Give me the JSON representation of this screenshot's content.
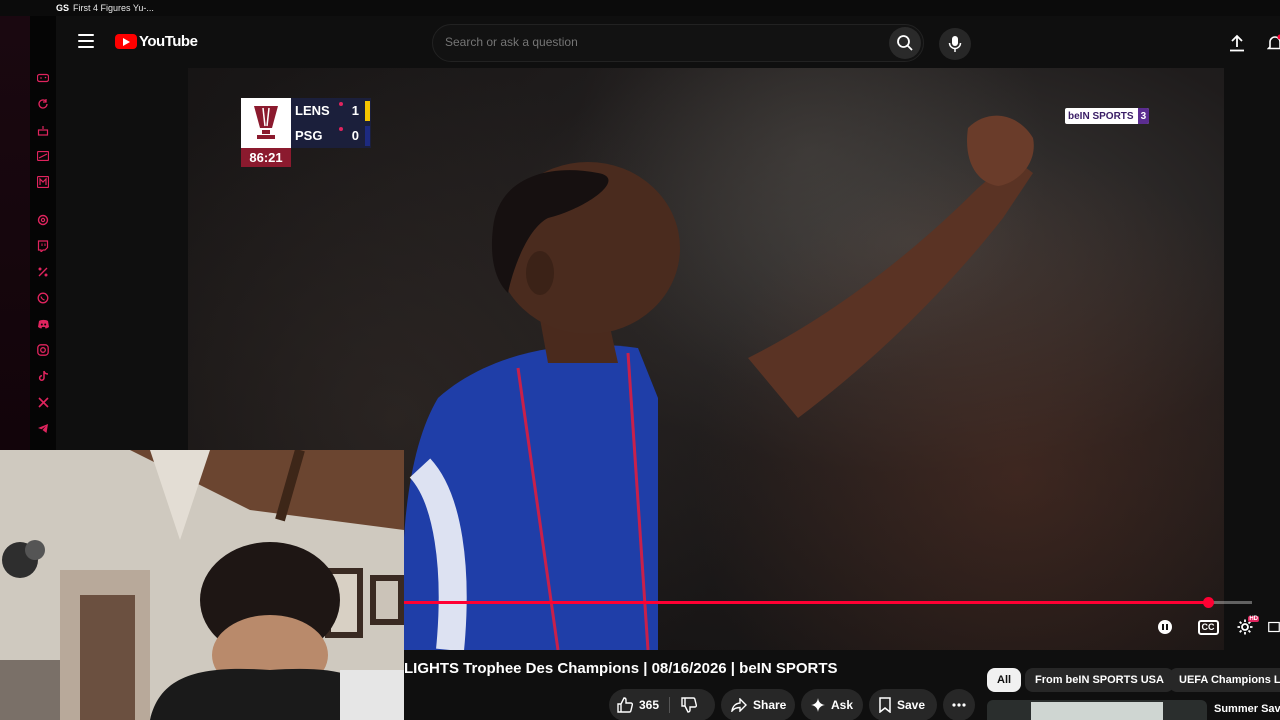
{
  "browser": {
    "tab_favicon": "GS",
    "tab_title": "First 4 Figures Yu-..."
  },
  "side_rail": {
    "icons": [
      "gamepad-icon",
      "refresh-icon",
      "cake-icon",
      "card-icon",
      "m-icon",
      "openai-icon",
      "twitch-icon",
      "percent-icon",
      "whatsapp-icon",
      "discord-icon",
      "instagram-icon",
      "tiktok-icon",
      "x-icon",
      "telegram-icon"
    ],
    "accent_color": "#e0245e"
  },
  "header": {
    "logo_text": "YouTube",
    "search_placeholder": "Search or ask a question"
  },
  "player": {
    "scoreboard": {
      "home_team": "LENS",
      "home_score": "1",
      "away_team": "PSG",
      "away_score": "0",
      "clock": "86:21",
      "home_color": "#f5c400",
      "away_color": "#1d2a80"
    },
    "broadcaster": {
      "name": "beIN SPORTS",
      "channel": "3"
    },
    "progress_fraction": 0.948
  },
  "video": {
    "title": "LIGHTS Trophee Des Champions | 08/16/2026 | beIN SPORTS",
    "like_count": "365",
    "share_label": "Share",
    "ask_label": "Ask",
    "save_label": "Save"
  },
  "chips": [
    "All",
    "From beIN SPORTS USA",
    "UEFA Champions League"
  ],
  "recommendation": {
    "title": "Summer Savings"
  }
}
